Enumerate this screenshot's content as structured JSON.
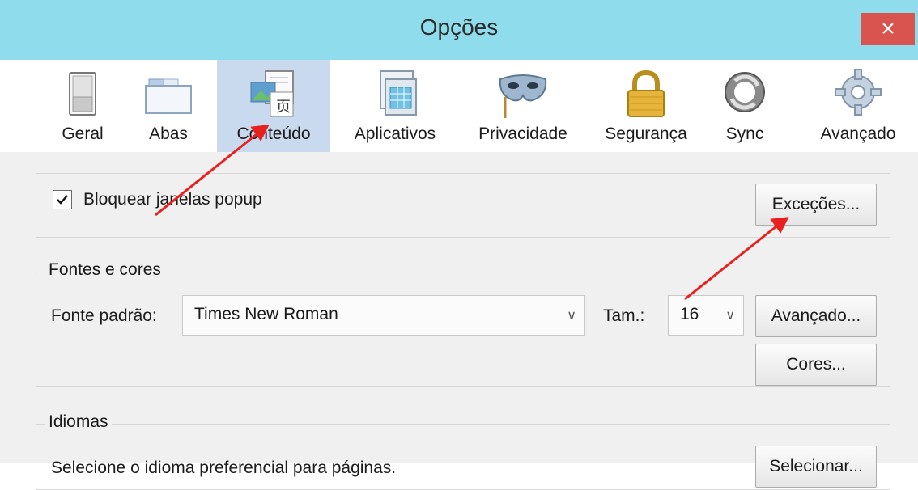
{
  "window": {
    "title": "Opções",
    "close_glyph": "×"
  },
  "tabs": [
    {
      "label": "Geral",
      "icon": "toggle-switch-icon"
    },
    {
      "label": "Abas",
      "icon": "folder-tabs-icon"
    },
    {
      "label": "Conteúdo",
      "icon": "content-page-icon",
      "active": true
    },
    {
      "label": "Aplicativos",
      "icon": "calendar-apps-icon"
    },
    {
      "label": "Privacidade",
      "icon": "mask-icon"
    },
    {
      "label": "Segurança",
      "icon": "padlock-icon"
    },
    {
      "label": "Sync",
      "icon": "sync-arrows-icon"
    },
    {
      "label": "Avançado",
      "icon": "gear-icon"
    }
  ],
  "popups": {
    "checkbox_label": "Bloquear janelas popup",
    "checked": true,
    "exceptions_button": "Exceções..."
  },
  "fonts": {
    "group_title": "Fontes e cores",
    "default_font_label": "Fonte padrão:",
    "default_font_value": "Times New Roman",
    "size_label": "Tam.:",
    "size_value": "16",
    "advanced_button": "Avançado...",
    "colors_button": "Cores..."
  },
  "languages": {
    "group_title": "Idiomas",
    "description": "Selecione o idioma preferencial para páginas.",
    "select_button": "Selecionar..."
  },
  "annotations": {
    "arrow_color": "#e8201e"
  },
  "colors": {
    "titlebar": "#8fdcec",
    "close": "#d9534f",
    "active_tab": "#c9d9ee"
  }
}
